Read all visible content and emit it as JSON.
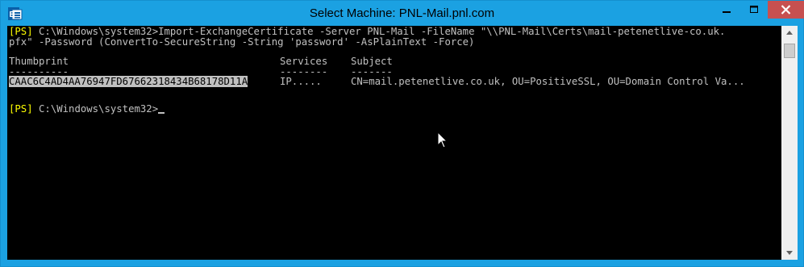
{
  "window": {
    "title": "Select Machine: PNL-Mail.pnl.com",
    "icon": "exchange-shell-icon",
    "controls": [
      "minimize-icon",
      "maximize-icon",
      "close-icon"
    ]
  },
  "console": {
    "line1_prompt": "[PS]",
    "line1_text": " C:\\Windows\\system32>Import-ExchangeCertificate -Server PNL-Mail -FileName \"\\\\PNL-Mail\\Certs\\mail-petenetlive-co.uk.",
    "line2_text": "pfx\" -Password (ConvertTo-SecureString -String 'password' -AsPlainText -Force)",
    "header": {
      "thumbprint": "Thumbprint",
      "services": "Services",
      "subject": "Subject"
    },
    "underline": {
      "thumbprint": "----------",
      "services": "--------",
      "subject": "-------"
    },
    "row": {
      "thumbprint": "CAAC6C4AD4AA76947FD67662318434B68178D11A",
      "services": "IP.....",
      "subject": "CN=mail.petenetlive.co.uk, OU=PositiveSSL, OU=Domain Control Va..."
    },
    "prompt2_tag": "[PS]",
    "prompt2_path": " C:\\Windows\\system32>"
  },
  "colors": {
    "titlebar": "#1ba1e2",
    "console_bg": "#000000",
    "console_text": "#c0c0c0",
    "prompt_tag": "#ffff00",
    "close_button": "#c75050"
  }
}
